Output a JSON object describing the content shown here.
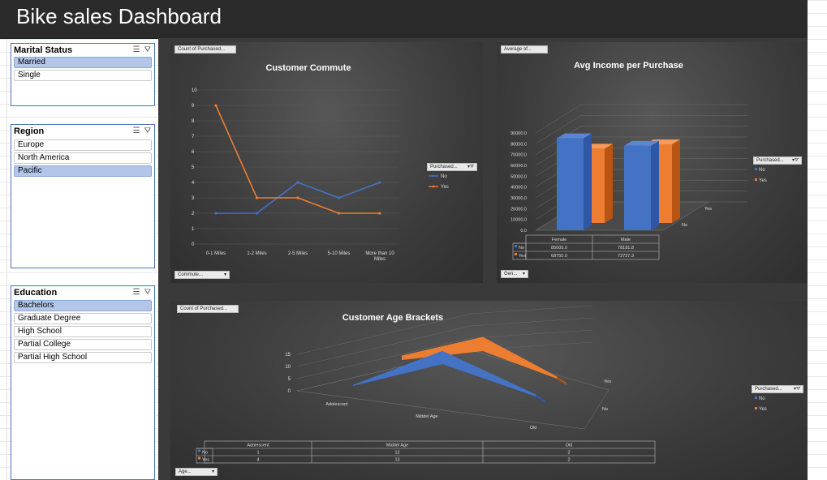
{
  "title": "Bike sales Dashboard",
  "slicers": {
    "marital": {
      "header": "Marital Status",
      "items": [
        {
          "label": "Married",
          "selected": true
        },
        {
          "label": "Single",
          "selected": false
        }
      ]
    },
    "region": {
      "header": "Region",
      "items": [
        {
          "label": "Europe",
          "selected": false
        },
        {
          "label": "North America",
          "selected": false
        },
        {
          "label": "Pacific",
          "selected": true
        }
      ]
    },
    "education": {
      "header": "Education",
      "items": [
        {
          "label": "Bachelors",
          "selected": true
        },
        {
          "label": "Graduate Degree",
          "selected": false
        },
        {
          "label": "High School",
          "selected": false
        },
        {
          "label": "Partial College",
          "selected": false
        },
        {
          "label": "Partial High School",
          "selected": false
        }
      ]
    }
  },
  "commute": {
    "field_button": "Count of Purchased...",
    "axis_button": "Commute...",
    "legend_button": "Purchased...",
    "chart_data": {
      "type": "line",
      "title": "Customer Commute",
      "categories": [
        "0-1 Miles",
        "1-2 Miles",
        "2-5 Miles",
        "5-10 Miles",
        "More than 10 Miles"
      ],
      "series": [
        {
          "name": "No",
          "color": "#4472c4",
          "values": [
            2,
            2,
            4,
            3,
            4
          ]
        },
        {
          "name": "Yes",
          "color": "#ed7d31",
          "values": [
            9,
            3,
            3,
            2,
            2
          ]
        }
      ],
      "ylim": [
        0,
        10
      ],
      "yticks": [
        "0",
        "1",
        "2",
        "3",
        "4",
        "5",
        "6",
        "7",
        "8",
        "9",
        "10"
      ],
      "grid": true,
      "legend_position": "right"
    }
  },
  "income": {
    "field_button": "Average of...",
    "axis_button": "Gen...",
    "legend_button": "Purchased...",
    "chart_data": {
      "type": "bar",
      "title": "Avg Income per Purchase",
      "categories": [
        "Female",
        "Male"
      ],
      "series": [
        {
          "name": "No",
          "color": "#4472c4",
          "values": [
            85000.0,
            78181.8
          ]
        },
        {
          "name": "Yes",
          "color": "#ed7d31",
          "values": [
            68750.0,
            72727.3
          ]
        }
      ],
      "ylim": [
        0,
        90000
      ],
      "yticks": [
        "0.0",
        "10000.0",
        "20000.0",
        "30000.0",
        "40000.0",
        "50000.0",
        "60000.0",
        "70000.0",
        "80000.0",
        "90000.0"
      ],
      "depth_labels": [
        "No",
        "Yes"
      ],
      "table": {
        "header": [
          "Female",
          "Male"
        ],
        "rows": [
          {
            "name": "No",
            "cells": [
              "85000.0",
              "78181.8"
            ]
          },
          {
            "name": "Yes",
            "cells": [
              "68750.0",
              "72727.3"
            ]
          }
        ]
      },
      "legend_position": "right"
    }
  },
  "age": {
    "field_button": "Count of Purchased...",
    "axis_button": "Age...",
    "legend_button": "Purchased...",
    "chart_data": {
      "type": "area",
      "title": "Customer Age Brackets",
      "categories": [
        "Adolescent",
        "Middel Age",
        "Old"
      ],
      "series": [
        {
          "name": "No",
          "color": "#4472c4",
          "values": [
            1,
            12,
            2
          ]
        },
        {
          "name": "Yes",
          "color": "#ed7d31",
          "values": [
            4,
            13,
            2
          ]
        }
      ],
      "ylim": [
        0,
        15
      ],
      "yticks": [
        "0",
        "5",
        "10",
        "15"
      ],
      "depth_labels": [
        "No",
        "Yes"
      ],
      "table": {
        "header": [
          "Adolescent",
          "Middel Age",
          "Old"
        ],
        "rows": [
          {
            "name": "No",
            "cells": [
              "1",
              "12",
              "2"
            ]
          },
          {
            "name": "Yes",
            "cells": [
              "4",
              "13",
              "2"
            ]
          }
        ]
      },
      "legend_position": "right"
    }
  },
  "icons": {
    "multi_select": "multi-select-icon",
    "clear_filter": "clear-filter-icon",
    "dropdown": "dropdown-arrow-icon",
    "filter": "filter-icon"
  }
}
